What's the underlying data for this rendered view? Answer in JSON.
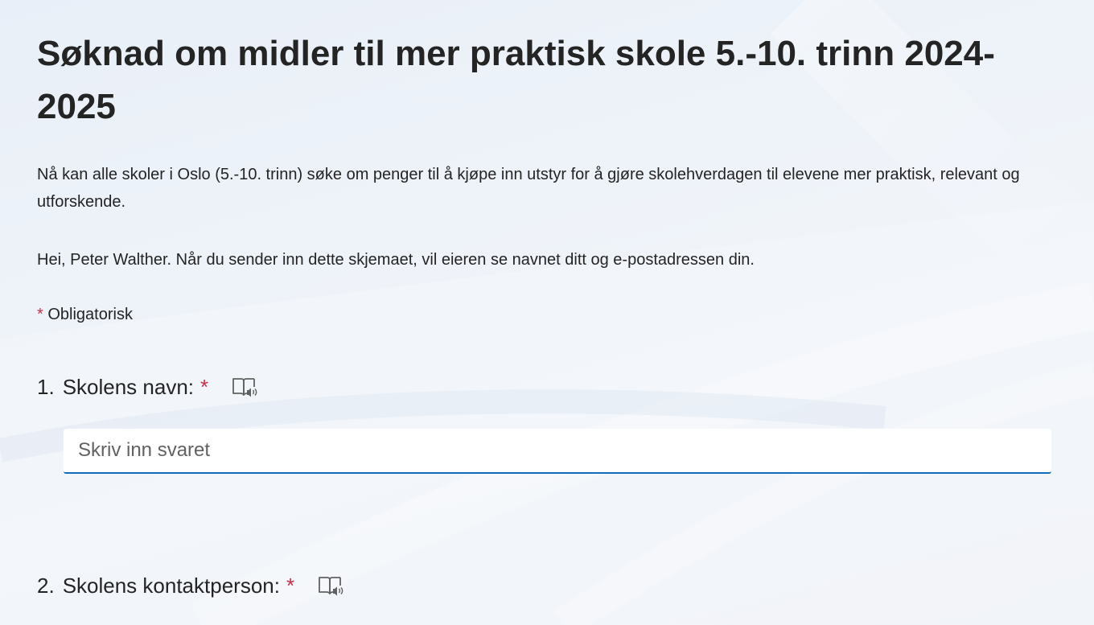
{
  "form": {
    "title": "Søknad om midler til mer praktisk skole 5.-10. trinn 2024-2025",
    "description": "Nå kan alle skoler i Oslo (5.-10. trinn) søke om penger til å kjøpe inn utstyr for å gjøre skolehverdagen til elevene mer praktisk, relevant og utforskende.",
    "greeting": "Hei, Peter Walther. Når du sender inn dette skjemaet, vil eieren se navnet ditt og e-postadressen din.",
    "required_note": {
      "asterisk": "*",
      "label": "Obligatorisk"
    }
  },
  "questions": [
    {
      "number": "1.",
      "label": "Skolens navn:",
      "required_mark": "*",
      "icon": "immersive-reader-icon",
      "answer": {
        "value": "",
        "placeholder": "Skriv inn svaret"
      }
    },
    {
      "number": "2.",
      "label": "Skolens kontaktperson:",
      "required_mark": "*",
      "icon": "immersive-reader-icon"
    }
  ],
  "colors": {
    "required": "#c4314b",
    "accent": "#0f6cbd",
    "text": "#242424"
  }
}
